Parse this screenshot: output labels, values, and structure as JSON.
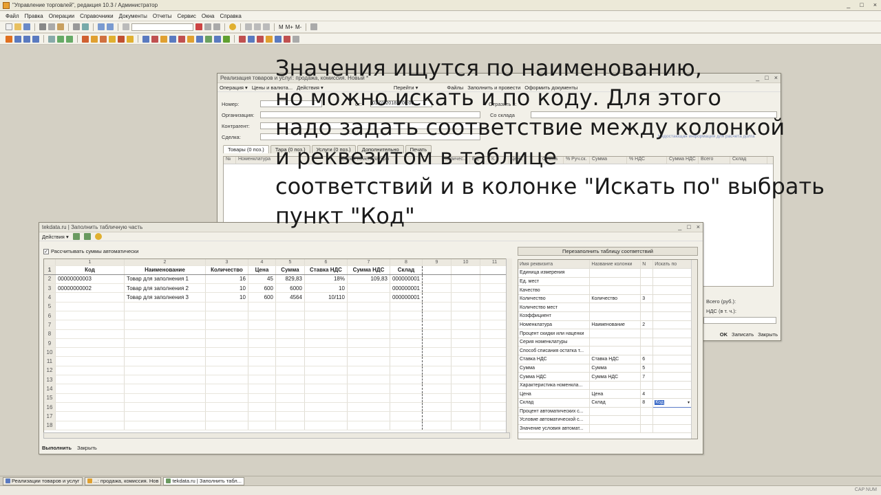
{
  "app": {
    "title": "\"Управление торговлей\", редакция 10.3 / Администратор",
    "win_controls": [
      "_",
      "□",
      "×"
    ]
  },
  "menu": [
    "Файл",
    "Правка",
    "Операции",
    "Справочники",
    "Документы",
    "Отчеты",
    "Сервис",
    "Окна",
    "Справка"
  ],
  "toolbar": {
    "mm": [
      "M",
      "M+",
      "M-"
    ]
  },
  "doc_window": {
    "title": "Реализация товаров и услуг: продажа, комиссия. Новый *",
    "actions": [
      "Операция ▾",
      "Цены и валюта...",
      "Действия ▾",
      "Перейти ▾",
      "Файлы",
      "Заполнить и провести",
      "Оформить документы"
    ],
    "fields": {
      "nomer": "Номер:",
      "org": "Организация:",
      "kontr": "Контрагент:",
      "sdelka": "Сделка:",
      "ot": "от:",
      "otrazit": "Отразить в:",
      "so_sklada": "Со склада",
      "date": "01.01.2018 0:00:00",
      "info": "Недостающая информация для расчета долга"
    },
    "tabs": [
      "Товары (0 поз.)",
      "Тара (0 поз.)",
      "Услуги (0 поз.)",
      "Дополнительно",
      "Печать"
    ],
    "columns": [
      "№",
      "Номенклатура",
      "Серия номенклатуры",
      "Количес...",
      "Ед.",
      "К.",
      "Цена",
      "Сумма",
      "% Руч.ск.",
      "Сумма",
      "% НДС",
      "Сумма НДС",
      "Всего",
      "Склад"
    ],
    "totals": {
      "vsego": "Всего (руб.):",
      "nds": "НДС (в т. ч.):"
    },
    "buttons": {
      "ok": "OK",
      "save": "Записать",
      "close": "Закрыть"
    }
  },
  "fill_window": {
    "title": "tekdata.ru | Заполнить табличную часть",
    "actions_label": "Действия ▾",
    "auto_sum_label": "Рассчитывать суммы автоматически",
    "refill_button": "Перезаполнить таблицу соответствий",
    "sheet": {
      "col_numbers": [
        "1",
        "2",
        "3",
        "4",
        "5",
        "6",
        "7",
        "8",
        "9",
        "10",
        "11"
      ],
      "headers": [
        "Код",
        "Наименование",
        "Количество",
        "Цена",
        "Сумма",
        "Ставка НДС",
        "Сумма НДС",
        "Склад",
        "",
        "",
        ""
      ],
      "rows": [
        [
          "00000000003",
          "Товар для заполнения 1",
          "16",
          "45",
          "829,83",
          "18%",
          "109,83",
          "000000001"
        ],
        [
          "00000000002",
          "Товар для заполнения 2",
          "10",
          "600",
          "6000",
          "10",
          "",
          "000000001"
        ],
        [
          "",
          "Товар для заполнения 3",
          "10",
          "600",
          "4564",
          "10/110",
          "",
          "000000001"
        ]
      ],
      "row_numbers": [
        "1",
        "2",
        "3",
        "4",
        "5",
        "6",
        "7",
        "8",
        "9",
        "10",
        "11",
        "12",
        "13",
        "14",
        "15",
        "16",
        "17",
        "18"
      ]
    },
    "mapping": {
      "headers": [
        "Имя реквизита",
        "Название колонки",
        "N",
        "Искать по"
      ],
      "rows": [
        [
          "Единица измерения",
          "",
          "",
          ""
        ],
        [
          "Ед. мест",
          "",
          "",
          ""
        ],
        [
          "Качество",
          "",
          "",
          ""
        ],
        [
          "Количество",
          "Количество",
          "3",
          ""
        ],
        [
          "Количество мест",
          "",
          "",
          ""
        ],
        [
          "Коэффициент",
          "",
          "",
          ""
        ],
        [
          "Номенклатура",
          "Наименование",
          "2",
          ""
        ],
        [
          "Процент скидки или наценки",
          "",
          "",
          ""
        ],
        [
          "Серия номенклатуры",
          "",
          "",
          ""
        ],
        [
          "Способ списания остатка т...",
          "",
          "",
          ""
        ],
        [
          "Ставка НДС",
          "Ставка НДС",
          "6",
          ""
        ],
        [
          "Сумма",
          "Сумма",
          "5",
          ""
        ],
        [
          "Сумма НДС",
          "Сумма НДС",
          "7",
          ""
        ],
        [
          "Характеристика номенкла...",
          "",
          "",
          ""
        ],
        [
          "Цена",
          "Цена",
          "4",
          ""
        ],
        [
          "Склад",
          "Склад",
          "8",
          "Код"
        ],
        [
          "Процент автоматических с...",
          "",
          "",
          ""
        ],
        [
          "Условие автоматической с...",
          "",
          "",
          ""
        ],
        [
          "Значение условия автомат...",
          "",
          "",
          ""
        ]
      ]
    },
    "footer": {
      "run": "Выполнить",
      "close": "Закрыть"
    }
  },
  "overlay": {
    "text": "Значения ищутся по наименованию,\nно можно искать и по коду. Для этого\nнадо задать соответствие между колонкой\nи реквезитом в таблице\nсоответствий и в колонке \"Искать по\" выбрать\nпункт \"Код\""
  },
  "taskbar": [
    "Реализации товаров и услуг",
    "...: продажа, комиссия. Нов",
    "tekdata.ru | Заполнить табл..."
  ],
  "status": "CAP  NUM"
}
